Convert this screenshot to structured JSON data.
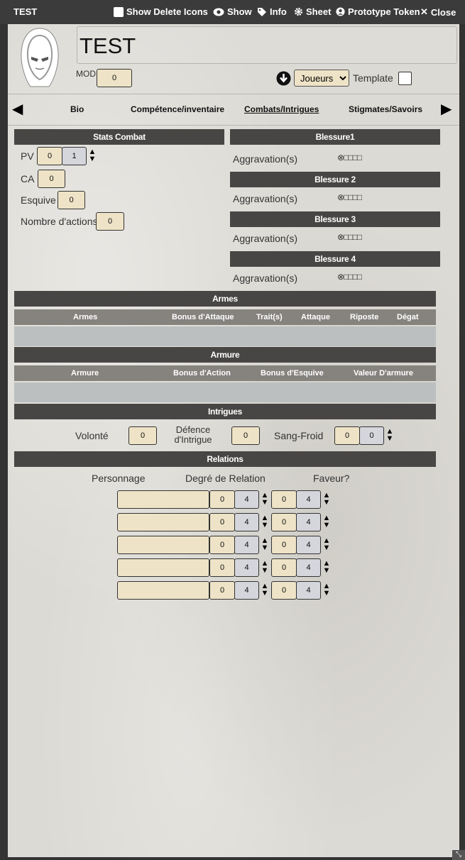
{
  "window": {
    "title": "TEST",
    "show_delete_icons": "Show Delete Icons",
    "show": "Show",
    "info": "Info",
    "sheet": "Sheet",
    "prototype_token": "Prototype Token",
    "close": "Close"
  },
  "character": {
    "name": "TEST",
    "mod_label": "MOD",
    "mod_value": "0"
  },
  "roll_target": {
    "selected": "Joueurs",
    "template_label": "Template"
  },
  "tabs": [
    "Bio",
    "Compétence/inventaire",
    "Combats/Intrigues",
    "Stigmates/Savoirs"
  ],
  "stats_combat": {
    "title": "Stats Combat",
    "pv_label": "PV",
    "pv_value": "0",
    "pv_max": "1",
    "ca_label": "CA",
    "ca_value": "0",
    "esquive_label": "Esquive",
    "esquive_value": "0",
    "actions_label": "Nombre d'actions",
    "actions_value": "0"
  },
  "blessures": [
    {
      "title": "Blessure1",
      "label": "Aggravation(s)",
      "boxes": "⊗□□□□"
    },
    {
      "title": "Blessure 2",
      "label": "Aggravation(s)",
      "boxes": "⊗□□□□"
    },
    {
      "title": "Blessure 3",
      "label": "Aggravation(s)",
      "boxes": "⊗□□□□"
    },
    {
      "title": "Blessure 4",
      "label": "Aggravation(s)",
      "boxes": "⊗□□□□"
    }
  ],
  "armes": {
    "title": "Armes",
    "columns": [
      "Armes",
      "Bonus d'Attaque",
      "Trait(s)",
      "Attaque",
      "Riposte",
      "Dégat"
    ]
  },
  "armure": {
    "title": "Armure",
    "columns": [
      "Armure",
      "Bonus d'Action",
      "Bonus d'Esquive",
      "Valeur D'armure"
    ]
  },
  "intrigues": {
    "title": "Intrigues",
    "volonte_label": "Volonté",
    "volonte_value": "0",
    "defence_label_1": "Défence",
    "defence_label_2": "d'Intrigue",
    "defence_value": "0",
    "sangfroid_label": "Sang-Froid",
    "sangfroid_value": "0",
    "sangfroid_max": "0"
  },
  "relations": {
    "title": "Relations",
    "col_personnage": "Personnage",
    "col_degre": "Degré de Relation",
    "col_faveur": "Faveur?",
    "rows": [
      {
        "name": "",
        "degre": "0",
        "degre_max": "4",
        "faveur": "0",
        "faveur_max": "4"
      },
      {
        "name": "",
        "degre": "0",
        "degre_max": "4",
        "faveur": "0",
        "faveur_max": "4"
      },
      {
        "name": "",
        "degre": "0",
        "degre_max": "4",
        "faveur": "0",
        "faveur_max": "4"
      },
      {
        "name": "",
        "degre": "0",
        "degre_max": "4",
        "faveur": "0",
        "faveur_max": "4"
      },
      {
        "name": "",
        "degre": "0",
        "degre_max": "4",
        "faveur": "0",
        "faveur_max": "4"
      }
    ]
  }
}
